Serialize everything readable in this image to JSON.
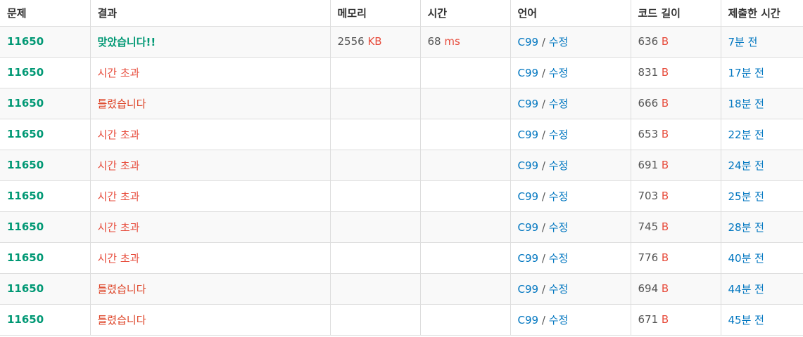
{
  "headers": {
    "problem": "문제",
    "result": "결과",
    "memory": "메모리",
    "time": "시간",
    "language": "언어",
    "code_length": "코드 길이",
    "submitted": "제출한 시간"
  },
  "colors": {
    "accepted": "#009874",
    "time_limit": "#e74c3c",
    "wrong_answer": "#dd4124",
    "link": "#0076c0",
    "unit": "#e74c3c"
  },
  "rows": [
    {
      "problem": "11650",
      "result": "맞았습니다!!",
      "result_type": "ac",
      "memory": "2556",
      "memory_unit": "KB",
      "time": "68",
      "time_unit": "ms",
      "language": "C99",
      "sep": "/",
      "edit": "수정",
      "code_length": "636",
      "length_unit": "B",
      "submitted": "7분 전"
    },
    {
      "problem": "11650",
      "result": "시간 초과",
      "result_type": "tle",
      "memory": "",
      "memory_unit": "",
      "time": "",
      "time_unit": "",
      "language": "C99",
      "sep": "/",
      "edit": "수정",
      "code_length": "831",
      "length_unit": "B",
      "submitted": "17분 전"
    },
    {
      "problem": "11650",
      "result": "틀렸습니다",
      "result_type": "wa",
      "memory": "",
      "memory_unit": "",
      "time": "",
      "time_unit": "",
      "language": "C99",
      "sep": "/",
      "edit": "수정",
      "code_length": "666",
      "length_unit": "B",
      "submitted": "18분 전"
    },
    {
      "problem": "11650",
      "result": "시간 초과",
      "result_type": "tle",
      "memory": "",
      "memory_unit": "",
      "time": "",
      "time_unit": "",
      "language": "C99",
      "sep": "/",
      "edit": "수정",
      "code_length": "653",
      "length_unit": "B",
      "submitted": "22분 전"
    },
    {
      "problem": "11650",
      "result": "시간 초과",
      "result_type": "tle",
      "memory": "",
      "memory_unit": "",
      "time": "",
      "time_unit": "",
      "language": "C99",
      "sep": "/",
      "edit": "수정",
      "code_length": "691",
      "length_unit": "B",
      "submitted": "24분 전"
    },
    {
      "problem": "11650",
      "result": "시간 초과",
      "result_type": "tle",
      "memory": "",
      "memory_unit": "",
      "time": "",
      "time_unit": "",
      "language": "C99",
      "sep": "/",
      "edit": "수정",
      "code_length": "703",
      "length_unit": "B",
      "submitted": "25분 전"
    },
    {
      "problem": "11650",
      "result": "시간 초과",
      "result_type": "tle",
      "memory": "",
      "memory_unit": "",
      "time": "",
      "time_unit": "",
      "language": "C99",
      "sep": "/",
      "edit": "수정",
      "code_length": "745",
      "length_unit": "B",
      "submitted": "28분 전"
    },
    {
      "problem": "11650",
      "result": "시간 초과",
      "result_type": "tle",
      "memory": "",
      "memory_unit": "",
      "time": "",
      "time_unit": "",
      "language": "C99",
      "sep": "/",
      "edit": "수정",
      "code_length": "776",
      "length_unit": "B",
      "submitted": "40분 전"
    },
    {
      "problem": "11650",
      "result": "틀렸습니다",
      "result_type": "wa",
      "memory": "",
      "memory_unit": "",
      "time": "",
      "time_unit": "",
      "language": "C99",
      "sep": "/",
      "edit": "수정",
      "code_length": "694",
      "length_unit": "B",
      "submitted": "44분 전"
    },
    {
      "problem": "11650",
      "result": "틀렸습니다",
      "result_type": "wa",
      "memory": "",
      "memory_unit": "",
      "time": "",
      "time_unit": "",
      "language": "C99",
      "sep": "/",
      "edit": "수정",
      "code_length": "671",
      "length_unit": "B",
      "submitted": "45분 전"
    }
  ]
}
